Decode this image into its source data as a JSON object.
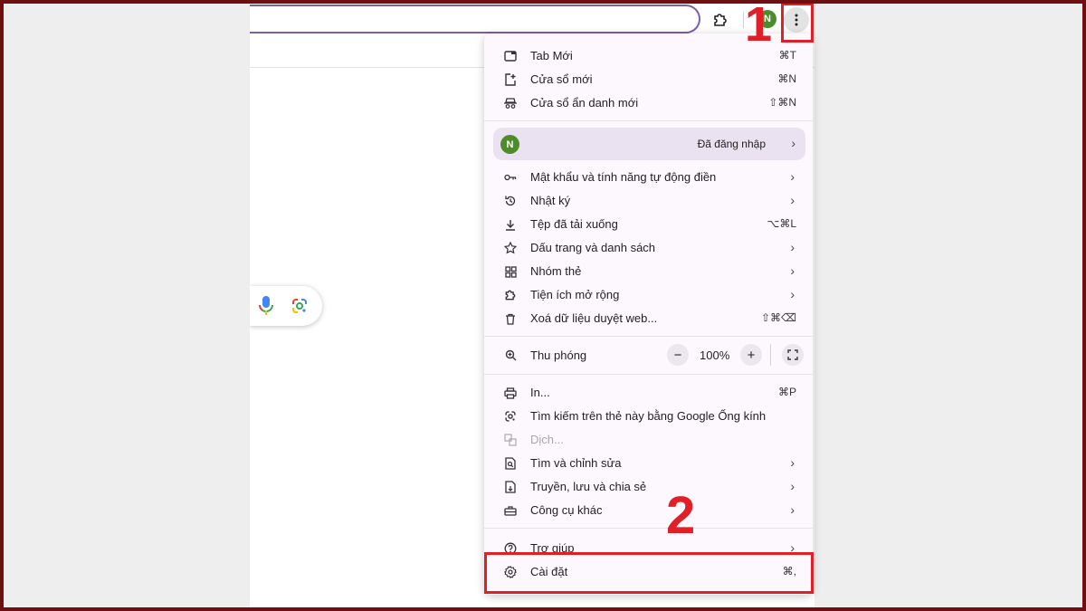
{
  "accent": "#e01f26",
  "avatar_color": "#4c8c2b",
  "toolbar": {
    "avatar_letter": "N",
    "extension_icon": "puzzle-icon",
    "menu_icon": "kebab-icon"
  },
  "annotations": {
    "step1": "1",
    "step2": "2"
  },
  "menu": {
    "new_tab": {
      "label": "Tab Mới",
      "shortcut": "⌘T"
    },
    "new_window": {
      "label": "Cửa sổ mới",
      "shortcut": "⌘N"
    },
    "incognito": {
      "label": "Cửa sổ ẩn danh mới",
      "shortcut": "⇧⌘N"
    },
    "profile": {
      "avatar": "N",
      "status": "Đã đăng nhập"
    },
    "passwords": {
      "label": "Mật khẩu và tính năng tự động điền"
    },
    "history": {
      "label": "Nhật ký"
    },
    "downloads": {
      "label": "Tệp đã tải xuống",
      "shortcut": "⌥⌘L"
    },
    "bookmarks": {
      "label": "Dấu trang và danh sách"
    },
    "tab_groups": {
      "label": "Nhóm thẻ"
    },
    "extensions": {
      "label": "Tiện ích mở rộng"
    },
    "clear_data": {
      "label": "Xoá dữ liệu duyệt web...",
      "shortcut": "⇧⌘⌫"
    },
    "zoom": {
      "label": "Thu phóng",
      "minus": "−",
      "value": "100%",
      "plus": "+"
    },
    "print": {
      "label": "In...",
      "shortcut": "⌘P"
    },
    "lens": {
      "label": "Tìm kiếm trên thẻ này bằng Google Ống kính"
    },
    "translate": {
      "label": "Dịch..."
    },
    "find_edit": {
      "label": "Tìm và chỉnh sửa"
    },
    "cast_save": {
      "label": "Truyền, lưu và chia sẻ"
    },
    "more_tools": {
      "label": "Công cụ khác"
    },
    "help": {
      "label": "Trợ giúp"
    },
    "settings": {
      "label": "Cài đặt",
      "shortcut": "⌘,"
    },
    "chevron": "›"
  }
}
